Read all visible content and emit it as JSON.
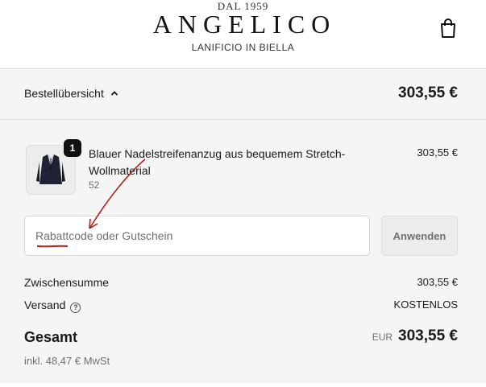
{
  "header": {
    "logo_year": "DAL 1959",
    "logo_name": "ANGELICO",
    "logo_subtitle": "LANIFICIO IN BIELLA",
    "cart_icon": "shopping-bag-icon"
  },
  "summary": {
    "toggle_label": "Bestellübersicht",
    "toggle_icon": "chevron-up-icon",
    "total": "303,55 €"
  },
  "item": {
    "quantity": "1",
    "name": "Blauer Nadelstreifenanzug aus bequemem Stretch-Wollmaterial",
    "variant": "52",
    "price": "303,55 €"
  },
  "discount": {
    "placeholder": "Rabattcode oder Gutschein",
    "apply_label": "Anwenden"
  },
  "totals": {
    "subtotal_label": "Zwischensumme",
    "subtotal_value": "303,55 €",
    "shipping_label": "Versand",
    "shipping_value": "KOSTENLOS",
    "total_label": "Gesamt",
    "currency": "EUR",
    "total_value": "303,55 €",
    "tax_note": "inkl. 48,47 € MwSt"
  },
  "colors": {
    "annotation": "#b3221c"
  }
}
